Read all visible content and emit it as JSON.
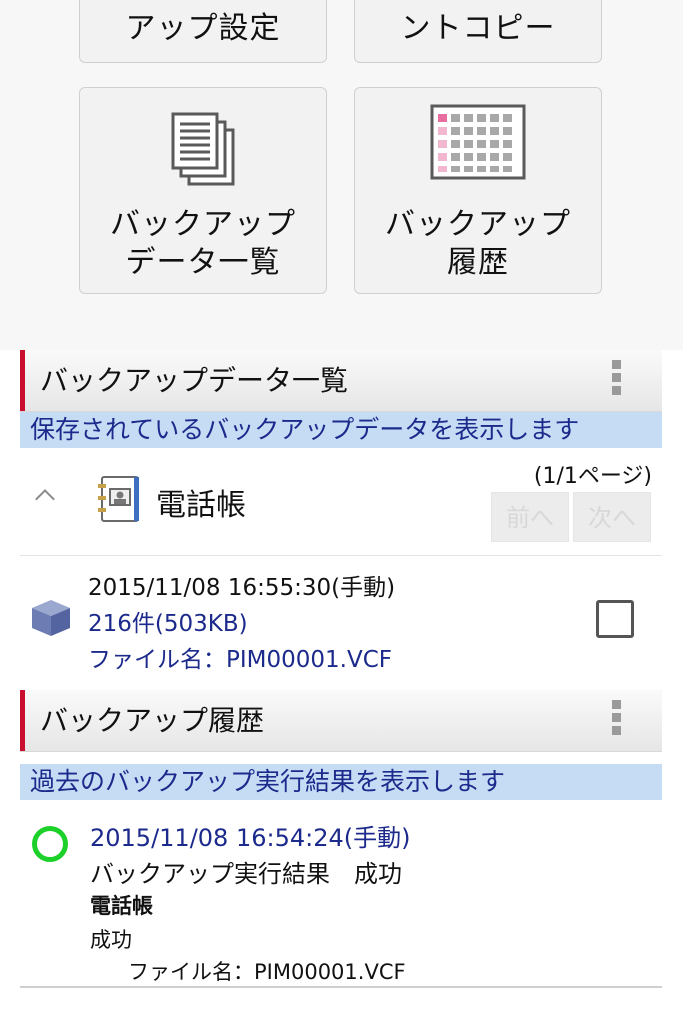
{
  "tiles": {
    "app_settings": "アップ設定",
    "print_copy": "ントコピー",
    "backup_list": "バックアップ\nデータ一覧",
    "backup_history": "バックアップ\n履歴"
  },
  "backup_data_section": {
    "title": "バックアップデータ一覧",
    "description": "保存されているバックアップデータを表示します",
    "group": {
      "title": "電話帳",
      "page_indicator": "(1/1ページ)",
      "prev_label": "前へ",
      "next_label": "次へ"
    },
    "item": {
      "datetime": "2015/11/08 16:55:30(手動)",
      "count_size": "216件(503KB)",
      "filename": "ファイル名：PIM00001.VCF",
      "checked": false
    }
  },
  "backup_history_section": {
    "title": "バックアップ履歴",
    "description": "過去のバックアップ実行結果を表示します",
    "item": {
      "datetime": "2015/11/08 16:54:24(手動)",
      "result": "バックアップ実行結果　成功",
      "category": "電話帳",
      "status": "成功",
      "filename": "ファイル名：PIM00001.VCF"
    }
  },
  "colors": {
    "accent": "#c8102e",
    "subtitle_bg": "#c6dcf5",
    "link_blue": "#1c2a8c",
    "success_green": "#1ed12a"
  }
}
